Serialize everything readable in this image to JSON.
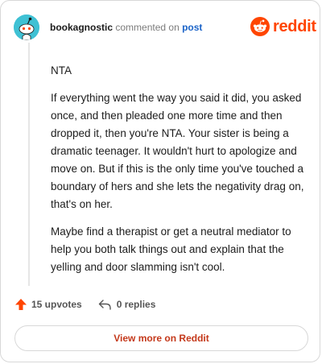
{
  "header": {
    "author": "bookagnostic",
    "action": "commented on",
    "target": "post"
  },
  "logo": {
    "text": "reddit",
    "icon": "reddit-snoo-icon",
    "color": "#ff4500"
  },
  "comment": {
    "paragraphs": [
      "NTA",
      "If everything went the way you said it did, you asked once, and then pleaded one more time and then dropped it, then you're NTA. Your sister is being a dramatic teenager. It wouldn't hurt to apologize and move on. But if this is the only time you've touched a boundary of hers and she lets the negativity drag on, that's on her.",
      "Maybe find a therapist or get a neutral mediator to help you both talk things out and explain that the yelling and door slamming isn't cool."
    ]
  },
  "footer": {
    "upvotes_label": "15 upvotes",
    "upvote_icon": "upvote-arrow-icon",
    "replies_label": "0 replies",
    "reply_icon": "reply-arrow-icon"
  },
  "view_more_label": "View more on Reddit",
  "colors": {
    "avatar": "#3fc1d4",
    "link": "#1c64c8",
    "accent": "#ff4500",
    "view_more": "#c4381a"
  }
}
